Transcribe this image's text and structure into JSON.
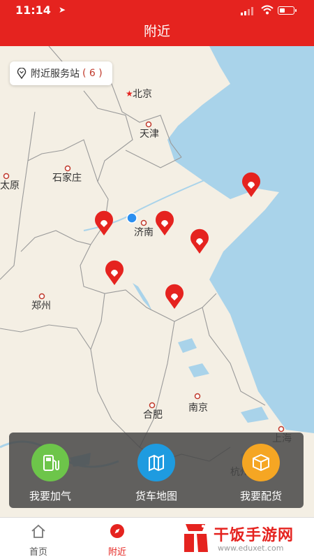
{
  "status": {
    "time": "11:14",
    "location_arrow": "location-arrow-icon"
  },
  "navbar": {
    "title": "附近"
  },
  "stations_chip": {
    "label": "附近服务站",
    "count": "( 6 )"
  },
  "map": {
    "cities": [
      "北京",
      "天津",
      "石家庄",
      "太原",
      "济南",
      "郑州",
      "合肥",
      "南京",
      "上海",
      "杭州"
    ],
    "markers_count": 6
  },
  "actions": [
    {
      "label": "我要加气",
      "icon": "gas-pump-icon",
      "color": "#6dc54a"
    },
    {
      "label": "货车地图",
      "icon": "map-icon",
      "color": "#1e9be0"
    },
    {
      "label": "我要配货",
      "icon": "package-icon",
      "color": "#f5a623"
    }
  ],
  "tabs": [
    {
      "label": "首页",
      "icon": "home-icon"
    },
    {
      "label": "附近",
      "icon": "compass-icon"
    }
  ],
  "watermark": {
    "brand": "干饭手游网",
    "url": "www.eduxet.com"
  },
  "colors": {
    "brand_red": "#e5231f",
    "sea": "#a9d3ea",
    "land": "#f4efe4"
  }
}
